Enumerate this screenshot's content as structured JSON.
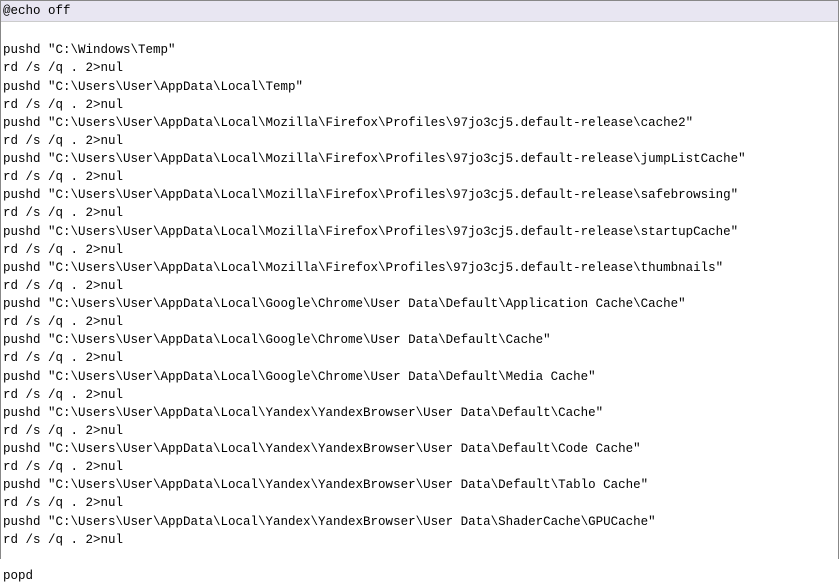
{
  "header": "@echo off",
  "lines": [
    "",
    "pushd \"C:\\Windows\\Temp\"",
    "rd /s /q . 2>nul",
    "pushd \"C:\\Users\\User\\AppData\\Local\\Temp\"",
    "rd /s /q . 2>nul",
    "pushd \"C:\\Users\\User\\AppData\\Local\\Mozilla\\Firefox\\Profiles\\97jo3cj5.default-release\\cache2\"",
    "rd /s /q . 2>nul",
    "pushd \"C:\\Users\\User\\AppData\\Local\\Mozilla\\Firefox\\Profiles\\97jo3cj5.default-release\\jumpListCache\"",
    "rd /s /q . 2>nul",
    "pushd \"C:\\Users\\User\\AppData\\Local\\Mozilla\\Firefox\\Profiles\\97jo3cj5.default-release\\safebrowsing\"",
    "rd /s /q . 2>nul",
    "pushd \"C:\\Users\\User\\AppData\\Local\\Mozilla\\Firefox\\Profiles\\97jo3cj5.default-release\\startupCache\"",
    "rd /s /q . 2>nul",
    "pushd \"C:\\Users\\User\\AppData\\Local\\Mozilla\\Firefox\\Profiles\\97jo3cj5.default-release\\thumbnails\"",
    "rd /s /q . 2>nul",
    "pushd \"C:\\Users\\User\\AppData\\Local\\Google\\Chrome\\User Data\\Default\\Application Cache\\Cache\"",
    "rd /s /q . 2>nul",
    "pushd \"C:\\Users\\User\\AppData\\Local\\Google\\Chrome\\User Data\\Default\\Cache\"",
    "rd /s /q . 2>nul",
    "pushd \"C:\\Users\\User\\AppData\\Local\\Google\\Chrome\\User Data\\Default\\Media Cache\"",
    "rd /s /q . 2>nul",
    "pushd \"C:\\Users\\User\\AppData\\Local\\Yandex\\YandexBrowser\\User Data\\Default\\Cache\"",
    "rd /s /q . 2>nul",
    "pushd \"C:\\Users\\User\\AppData\\Local\\Yandex\\YandexBrowser\\User Data\\Default\\Code Cache\"",
    "rd /s /q . 2>nul",
    "pushd \"C:\\Users\\User\\AppData\\Local\\Yandex\\YandexBrowser\\User Data\\Default\\Tablo Cache\"",
    "rd /s /q . 2>nul",
    "pushd \"C:\\Users\\User\\AppData\\Local\\Yandex\\YandexBrowser\\User Data\\ShaderCache\\GPUCache\"",
    "rd /s /q . 2>nul",
    "",
    "popd"
  ]
}
